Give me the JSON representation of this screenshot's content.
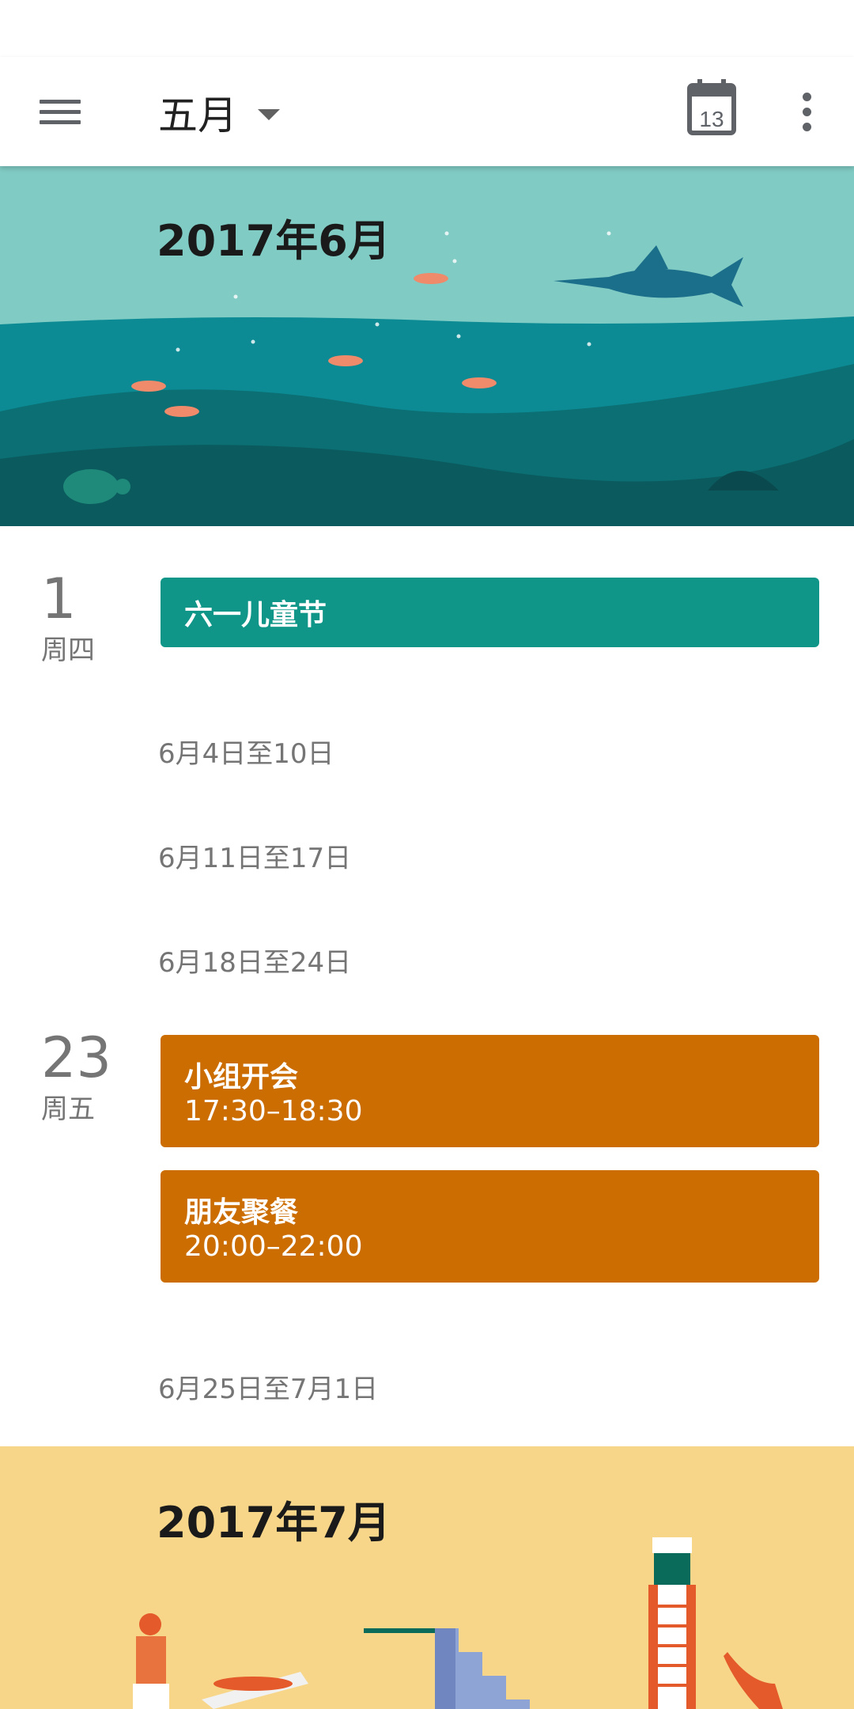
{
  "header": {
    "month": "五月",
    "today_day": "13"
  },
  "june": {
    "title": "2017年6月"
  },
  "days": [
    {
      "num": "1",
      "weekday": "周四",
      "events": [
        {
          "title": "六一儿童节",
          "time": "",
          "color": "#0f9688"
        }
      ]
    },
    {
      "num": "23",
      "weekday": "周五",
      "events": [
        {
          "title": "小组开会",
          "time": "17:30–18:30",
          "color": "#cb6d00"
        },
        {
          "title": "朋友聚餐",
          "time": "20:00–22:00",
          "color": "#cb6d00"
        }
      ]
    }
  ],
  "week_ranges": [
    "6月4日至10日",
    "6月11日至17日",
    "6月18日至24日",
    "6月25日至7月1日"
  ],
  "july": {
    "title": "2017年7月"
  },
  "colors": {
    "teal_event": "#0f9688",
    "orange_event": "#cb6d00",
    "june_sky": "#80cbc4",
    "july_bg": "#f7d68a"
  }
}
